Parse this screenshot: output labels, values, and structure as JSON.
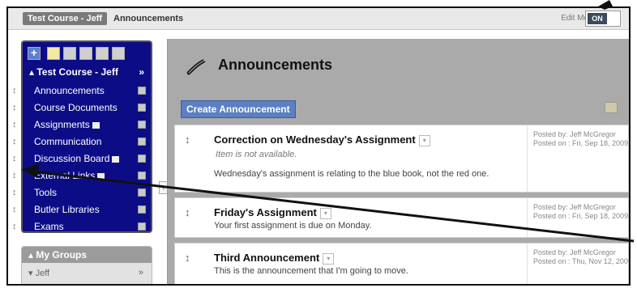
{
  "breadcrumb": {
    "course": "Test Course - Jeff",
    "page": "Announcements"
  },
  "edit_mode": {
    "label": "Edit Mode:",
    "state": "ON"
  },
  "menu": {
    "course_title": "Test Course - Jeff",
    "items": [
      {
        "label": "Announcements"
      },
      {
        "label": "Course Documents"
      },
      {
        "label": "Assignments"
      },
      {
        "label": "Communication"
      },
      {
        "label": "Discussion Board"
      },
      {
        "label": "External Links"
      },
      {
        "label": "Tools"
      },
      {
        "label": "Butler Libraries"
      },
      {
        "label": "Exams"
      }
    ]
  },
  "groups": {
    "title": "My Groups",
    "item": "Jeff"
  },
  "main": {
    "title": "Announcements",
    "create_button": "Create Announcement",
    "announcements": [
      {
        "title": "Correction on Wednesday's Assignment",
        "status": "Item is not available.",
        "body": "Wednesday's assignment is relating to the blue book, not the red one.",
        "posted_by": "Posted by: Jeff McGregor",
        "posted_on": "Posted on : Fri, Sep 18, 2009"
      },
      {
        "title": "Friday's Assignment",
        "body": "Your first assignment is due on Monday.",
        "posted_by": "Posted by: Jeff McGregor",
        "posted_on": "Posted on : Fri, Sep 18, 2009"
      },
      {
        "title": "Third Announcement",
        "body": "This is the announcement that I'm going to move.",
        "posted_by": "Posted by: Jeff McGregor",
        "posted_on": "Posted on : Thu, Nov 12, 2009"
      }
    ]
  },
  "colors": {
    "menu_bg": "#0c0d86",
    "main_bg": "#aaaaaa",
    "button_blue": "#5b7fc2"
  }
}
